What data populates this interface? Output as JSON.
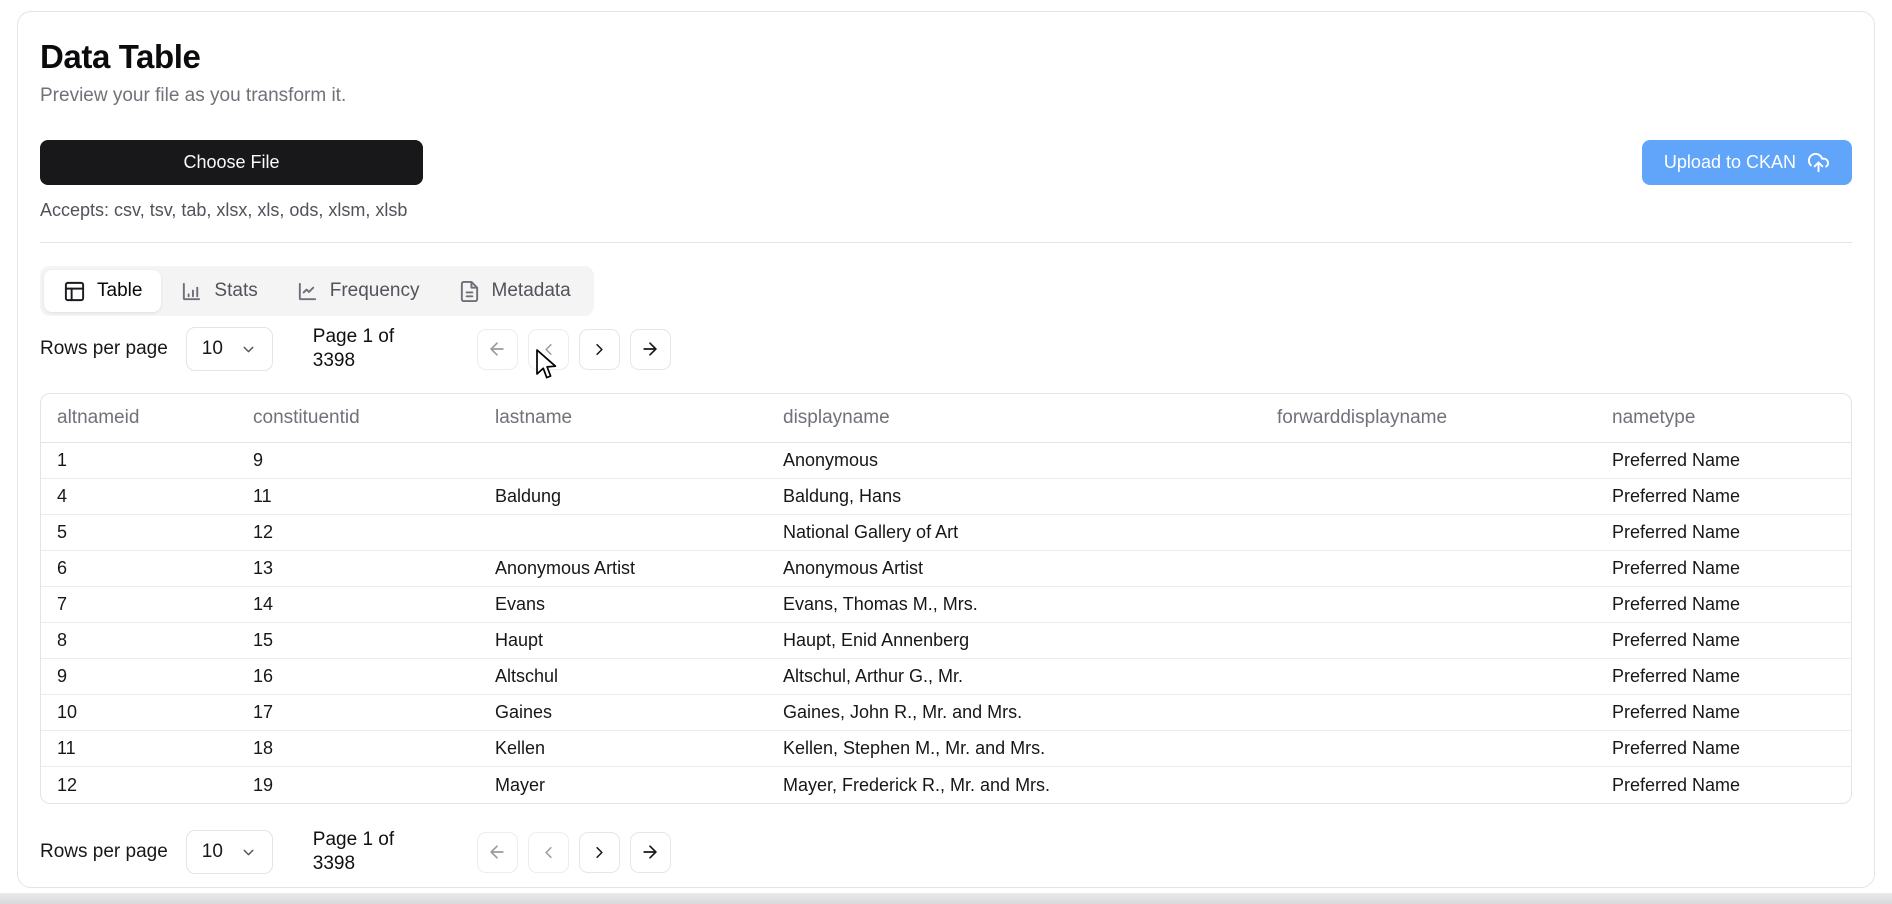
{
  "page": {
    "title": "Data Table",
    "subtitle": "Preview your file as you transform it."
  },
  "upload": {
    "choose_file_label": "Choose File",
    "accepts_text": "Accepts: csv, tsv, tab, xlsx, xls, ods, xlsm, xlsb",
    "ckan_button_label": "Upload to CKAN",
    "ckan_button_icon": "cloud-upload-icon"
  },
  "tabs": [
    {
      "label": "Table",
      "icon": "table-icon",
      "active": true
    },
    {
      "label": "Stats",
      "icon": "bar-chart-icon",
      "active": false
    },
    {
      "label": "Frequency",
      "icon": "line-chart-icon",
      "active": false
    },
    {
      "label": "Metadata",
      "icon": "file-text-icon",
      "active": false
    }
  ],
  "pagination": {
    "rows_per_page_label": "Rows per page",
    "rows_per_page_value": "10",
    "page_info": "Page 1 of 3398",
    "nav_icons": [
      "arrow-left-icon",
      "chevron-left-icon",
      "chevron-right-icon",
      "arrow-right-icon"
    ],
    "first_prev_disabled": true,
    "next_last_enabled": true
  },
  "table": {
    "columns": [
      "altnameid",
      "constituentid",
      "lastname",
      "displayname",
      "forwarddisplayname",
      "nametype"
    ],
    "rows": [
      [
        "1",
        "9",
        "",
        "Anonymous",
        "",
        "Preferred Name"
      ],
      [
        "4",
        "11",
        "Baldung",
        "Baldung, Hans",
        "",
        "Preferred Name"
      ],
      [
        "5",
        "12",
        "",
        "National Gallery of Art",
        "",
        "Preferred Name"
      ],
      [
        "6",
        "13",
        "Anonymous Artist",
        "Anonymous Artist",
        "",
        "Preferred Name"
      ],
      [
        "7",
        "14",
        "Evans",
        "Evans, Thomas M., Mrs.",
        "",
        "Preferred Name"
      ],
      [
        "8",
        "15",
        "Haupt",
        "Haupt, Enid Annenberg",
        "",
        "Preferred Name"
      ],
      [
        "9",
        "16",
        "Altschul",
        "Altschul, Arthur G., Mr.",
        "",
        "Preferred Name"
      ],
      [
        "10",
        "17",
        "Gaines",
        "Gaines, John R., Mr. and Mrs.",
        "",
        "Preferred Name"
      ],
      [
        "11",
        "18",
        "Kellen",
        "Kellen, Stephen M., Mr. and Mrs.",
        "",
        "Preferred Name"
      ],
      [
        "12",
        "19",
        "Mayer",
        "Mayer, Frederick R., Mr. and Mrs.",
        "",
        "Preferred Name"
      ]
    ]
  },
  "colors": {
    "accent_blue": "#60a5fa",
    "dark_button": "#18181b",
    "border": "#e4e4e7",
    "muted_text": "#71717a"
  }
}
